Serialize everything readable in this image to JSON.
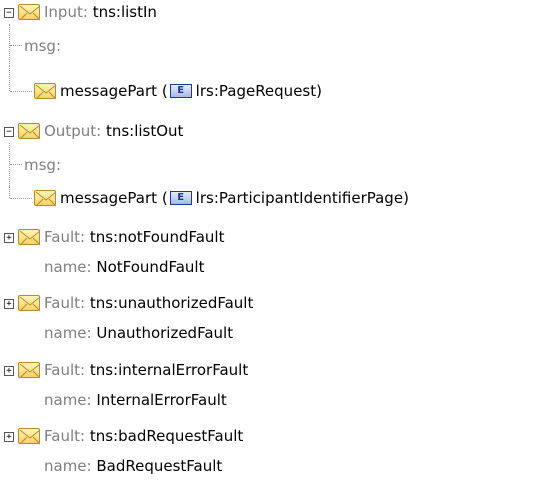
{
  "tree": {
    "input": {
      "keyword": "Input:",
      "value": "tns:listIn",
      "msg_label": "msg:",
      "part_label": "messagePart",
      "open_paren": "(",
      "e_glyph": "E",
      "type": "lrs:PageRequest",
      "close_paren": ")"
    },
    "output": {
      "keyword": "Output:",
      "value": "tns:listOut",
      "msg_label": "msg:",
      "part_label": "messagePart",
      "open_paren": "(",
      "e_glyph": "E",
      "type": "lrs:ParticipantIdentifierPage",
      "close_paren": ")"
    },
    "faults": [
      {
        "keyword": "Fault:",
        "value": "tns:notFoundFault",
        "name_label": "name:",
        "name": "NotFoundFault"
      },
      {
        "keyword": "Fault:",
        "value": "tns:unauthorizedFault",
        "name_label": "name:",
        "name": "UnauthorizedFault"
      },
      {
        "keyword": "Fault:",
        "value": "tns:internalErrorFault",
        "name_label": "name:",
        "name": "InternalErrorFault"
      },
      {
        "keyword": "Fault:",
        "value": "tns:badRequestFault",
        "name_label": "name:",
        "name": "BadRequestFault"
      }
    ],
    "collapse_glyph": "−",
    "expand_glyph": "+",
    "envelope_icon": "envelope-icon",
    "element_icon": "element-type-icon"
  }
}
